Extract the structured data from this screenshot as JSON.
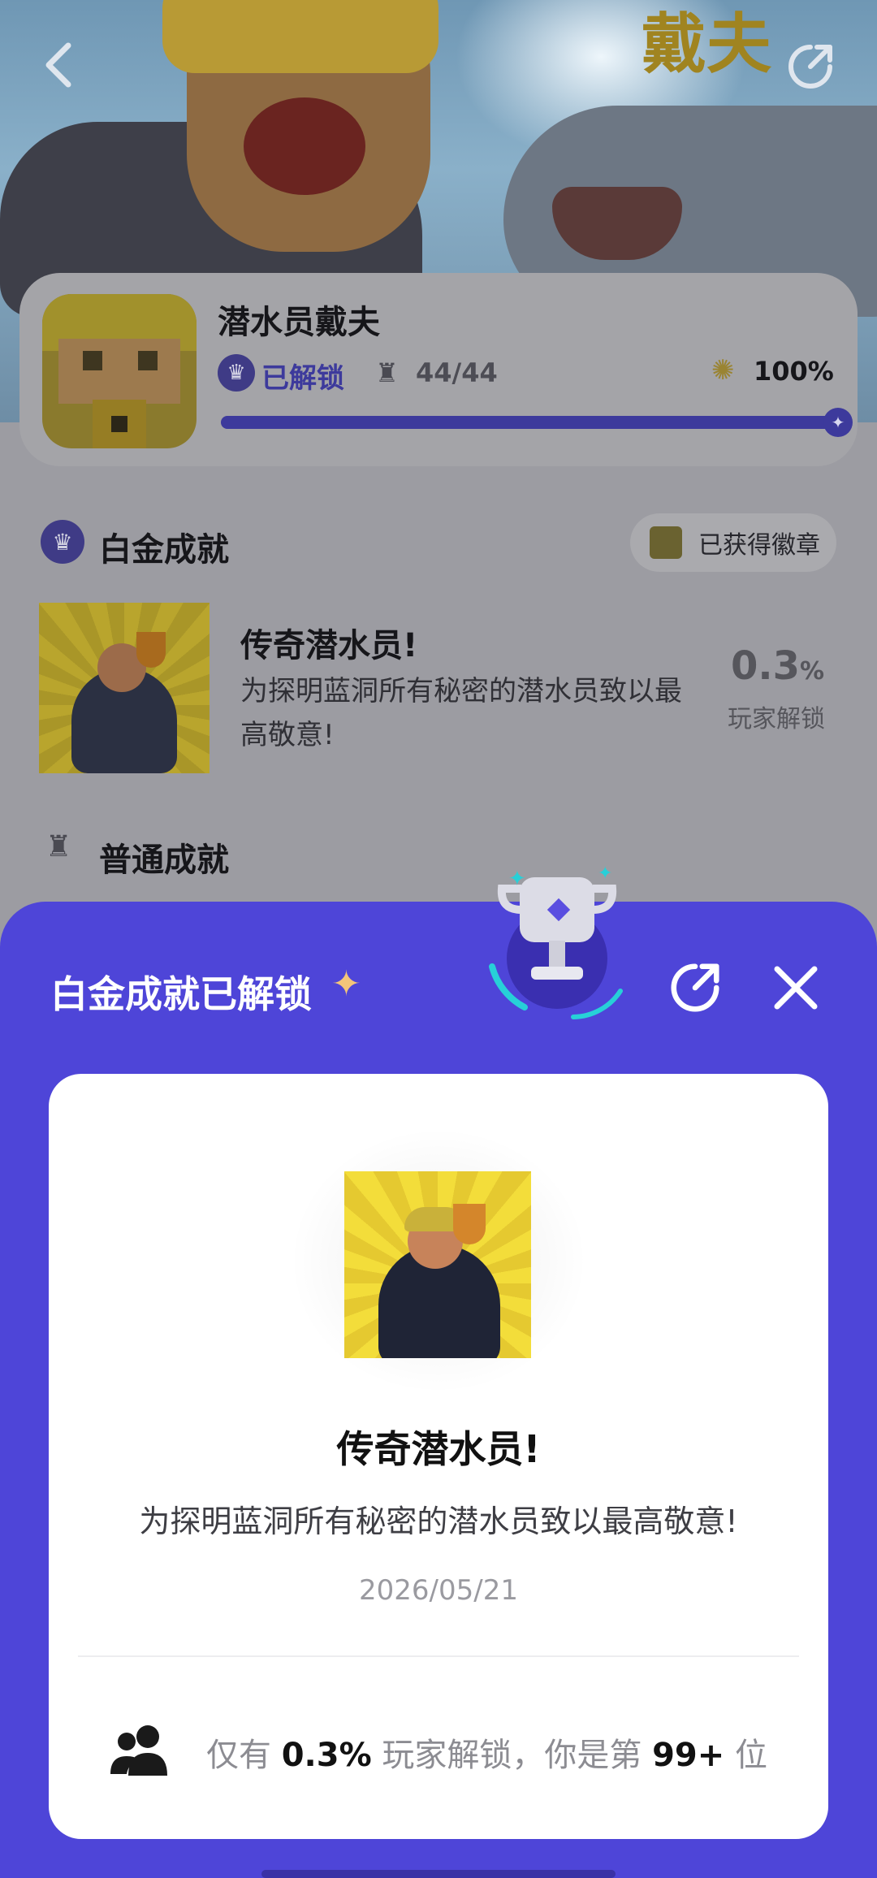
{
  "header": {
    "back_icon": "chevron-left-icon",
    "share_icon": "share-icon",
    "hero_art_text": "戴夫"
  },
  "game": {
    "title": "潜水员戴夫",
    "unlocked_label": "已解锁",
    "trophy_count": "44/44",
    "completion_percent": "100%",
    "progress": 1.0
  },
  "platinum_section": {
    "title": "白金成就",
    "badge_button_label": "已获得徽章",
    "achievement": {
      "name": "传奇潜水员!",
      "description": "为探明蓝洞所有秘密的潜水员致以最高敬意!",
      "rate_value": "0.3",
      "rate_unit": "%",
      "rate_label": "玩家解锁"
    }
  },
  "normal_section": {
    "title": "普通成就"
  },
  "popup": {
    "title": "白金成就已解锁",
    "card": {
      "name": "传奇潜水员!",
      "description": "为探明蓝洞所有秘密的潜水员致以最高敬意!",
      "date": "2026/05/21",
      "stat_prefix": "仅有",
      "stat_rate": "0.3%",
      "stat_middle": "玩家解锁，你是第",
      "stat_rank": "99+",
      "stat_suffix": "位"
    }
  },
  "colors": {
    "accent": "#4e45d8",
    "accent_dark": "#3d3a9c",
    "card_bg": "#ffffff"
  }
}
